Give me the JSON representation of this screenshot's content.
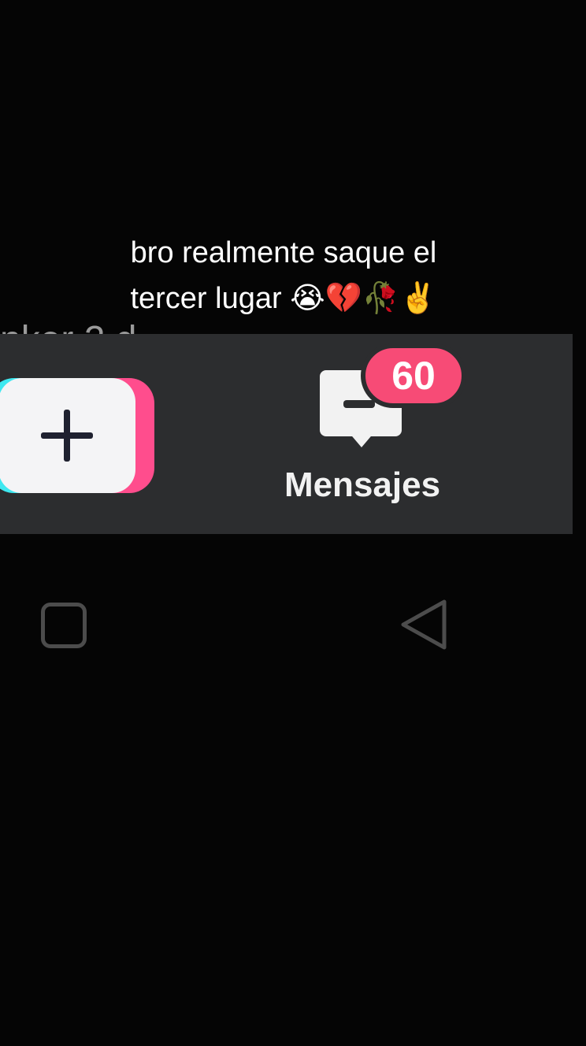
{
  "caption": {
    "line1": "bro realmente saque el",
    "line2": "tercer lugar 😭💔🥀✌️"
  },
  "background_text": "nker 2 d",
  "nav": {
    "create_icon": "plus-icon",
    "inbox_icon": "message-bubble-icon",
    "inbox_badge": "60",
    "inbox_label": "Mensajes"
  },
  "system_nav": {
    "recents_icon": "square-recents-icon",
    "back_icon": "triangle-back-icon"
  },
  "colors": {
    "background": "#050505",
    "nav_bar": "#2c2d2f",
    "badge": "#f74b76",
    "create_cyan": "#3ee8f0",
    "create_pink": "#ff4d8d",
    "text": "#ffffff"
  }
}
